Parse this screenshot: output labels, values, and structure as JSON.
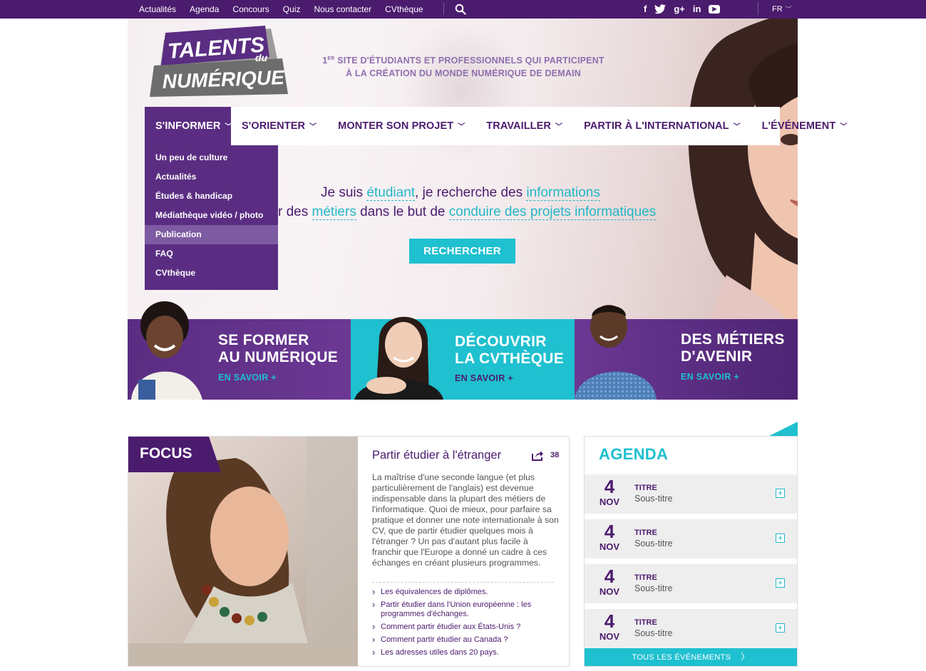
{
  "topbar": {
    "links": [
      "Actualités",
      "Agenda",
      "Concours",
      "Quiz",
      "Nous contacter",
      "CVthèque"
    ],
    "social": [
      "f",
      "twitter-icon",
      "g+",
      "in",
      "youtube-icon"
    ],
    "lang": "FR"
  },
  "logo": {
    "line1": "TALENTS",
    "line2": "du",
    "line3": "NUMÉRIQUE"
  },
  "tagline": {
    "line1_pre": "1",
    "line1_sup": "ER",
    "line1_rest": " SITE D'ÉTUDIANTS ET PROFESSIONNELS QUI PARTICIPENT",
    "line2": "À LA CRÉATION DU MONDE NUMÉRIQUE DE DEMAIN"
  },
  "nav": {
    "items": [
      "S'INFORMER",
      "S'ORIENTER",
      "MONTER SON PROJET",
      "TRAVAILLER",
      "PARTIR À L'INTERNATIONAL",
      "L'ÉVÉNEMENT"
    ],
    "active_index": 0
  },
  "dropdown": {
    "items": [
      "Un peu de culture",
      "Actualités",
      "Études & handicap",
      "Médiathèque vidéo / photo",
      "Publication",
      "FAQ",
      "CVthèque"
    ],
    "selected_index": 4
  },
  "hero": {
    "l1_a": "Je suis ",
    "l1_kw1": "étudiant",
    "l1_b": ", je recherche des ",
    "l1_kw2": "informations",
    "l2_a": "r des ",
    "l2_kw1": "métiers",
    "l2_b": " dans le but de ",
    "l2_kw2": "conduire des projets informatiques",
    "button": "RECHERCHER"
  },
  "banners": [
    {
      "title1": "SE FORMER",
      "title2": "AU NUMÉRIQUE",
      "more": "EN SAVOIR +"
    },
    {
      "title1": "DÉCOUVRIR",
      "title2": "LA CVTHÈQUE",
      "more": "EN SAVOIR +"
    },
    {
      "title1": "DES MÉTIERS",
      "title2": "D'AVENIR",
      "more": "EN SAVOIR +"
    }
  ],
  "focus": {
    "label": "FOCUS",
    "title": "Partir étudier à l'étranger",
    "share_count": "38",
    "body": "La maîtrise d'une seconde langue (et plus particulièrement de l'anglais) est devenue indispensable dans la plupart des métiers de l'informatique. Quoi de mieux, pour parfaire sa pratique et donner une note internationale à son CV, que de partir étudier quelques mois à l'étranger ? Un pas d'autant plus facile à franchir que l'Europe a donné un cadre à ces échanges en créant plusieurs programmes.",
    "links": [
      "Les équivalences de diplômes.",
      "Partir étudier dans l'Union européenne : les programmes d'échanges.",
      "Comment partir étudier aux États-Unis ?",
      "Comment partir étudier au Canada ?",
      "Les adresses utiles dans 20 pays."
    ]
  },
  "agenda": {
    "heading": "AGENDA",
    "events": [
      {
        "day": "4",
        "month": "NOV",
        "title": "TITRE",
        "subtitle": "Sous-titre"
      },
      {
        "day": "4",
        "month": "NOV",
        "title": "TITRE",
        "subtitle": "Sous-titre"
      },
      {
        "day": "4",
        "month": "NOV",
        "title": "TITRE",
        "subtitle": "Sous-titre"
      },
      {
        "day": "4",
        "month": "NOV",
        "title": "TITRE",
        "subtitle": "Sous-titre"
      }
    ],
    "all_events": "TOUS LES ÉVÉNEMENTS"
  },
  "colors": {
    "purple": "#4b1b6e",
    "purple_mid": "#5a2d82",
    "cyan": "#1fc0cf"
  }
}
